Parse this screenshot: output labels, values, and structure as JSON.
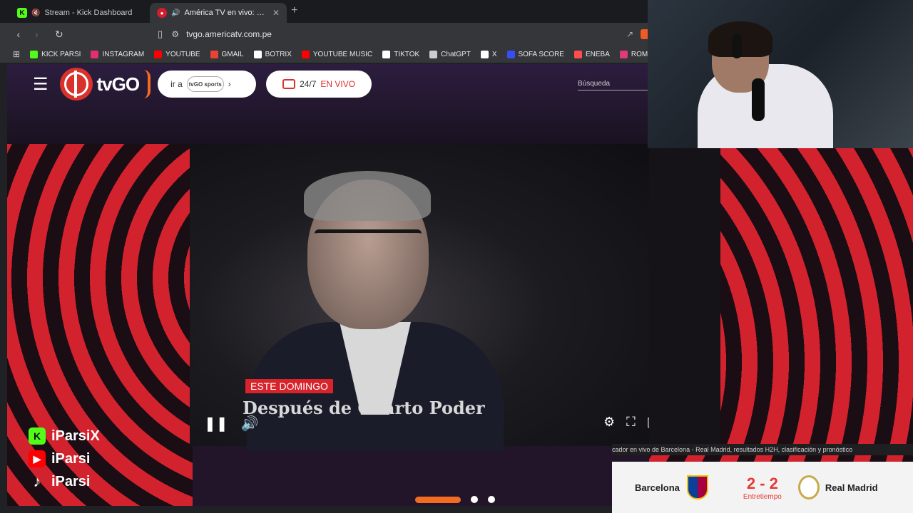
{
  "tabs": [
    {
      "label": "Stream - Kick Dashboard",
      "icon": "kick-icon"
    },
    {
      "label": "América TV en vivo: program",
      "icon": "america-tv-icon"
    }
  ],
  "address": {
    "url": "tvgo.americatv.com.pe"
  },
  "bookmarks": [
    {
      "label": "KICK PARSI",
      "color": "#53fc18"
    },
    {
      "label": "INSTAGRAM",
      "color": "#e1306c"
    },
    {
      "label": "YOUTUBE",
      "color": "#ff0000"
    },
    {
      "label": "GMAIL",
      "color": "#ea4335"
    },
    {
      "label": "BOTRIX",
      "color": "#ffffff"
    },
    {
      "label": "YOUTUBE MUSIC",
      "color": "#ff0000"
    },
    {
      "label": "TIKTOK",
      "color": "#ffffff"
    },
    {
      "label": "ChatGPT",
      "color": "#cccccc"
    },
    {
      "label": "X",
      "color": "#ffffff"
    },
    {
      "label": "SOFA SCORE",
      "color": "#374df5"
    },
    {
      "label": "ENEBA",
      "color": "#ff4c4c"
    },
    {
      "label": "ROMSFUN",
      "color": "#e03a7c"
    }
  ],
  "site": {
    "logo": "tvGO",
    "ira_label": "ir a",
    "tvgo_sports": "tvGO sports",
    "live_num": "24/7",
    "live_label": "EN VIVO",
    "search_placeholder": "Búsqueda"
  },
  "video": {
    "badge": "ESTE DOMINGO",
    "title": "Después de Cuarto Poder"
  },
  "score": {
    "headline": "cador en vivo de Barcelona - Real Madrid, resultados H2H, clasificación y pronóstico",
    "home": "Barcelona",
    "away": "Real Madrid",
    "result": "2 - 2",
    "status": "Entretiempo"
  },
  "social": [
    {
      "handle": "iParsiX",
      "icon": "kick-icon"
    },
    {
      "handle": "iParsi",
      "icon": "youtube-icon"
    },
    {
      "handle": "iParsi",
      "icon": "tiktok-icon"
    }
  ]
}
